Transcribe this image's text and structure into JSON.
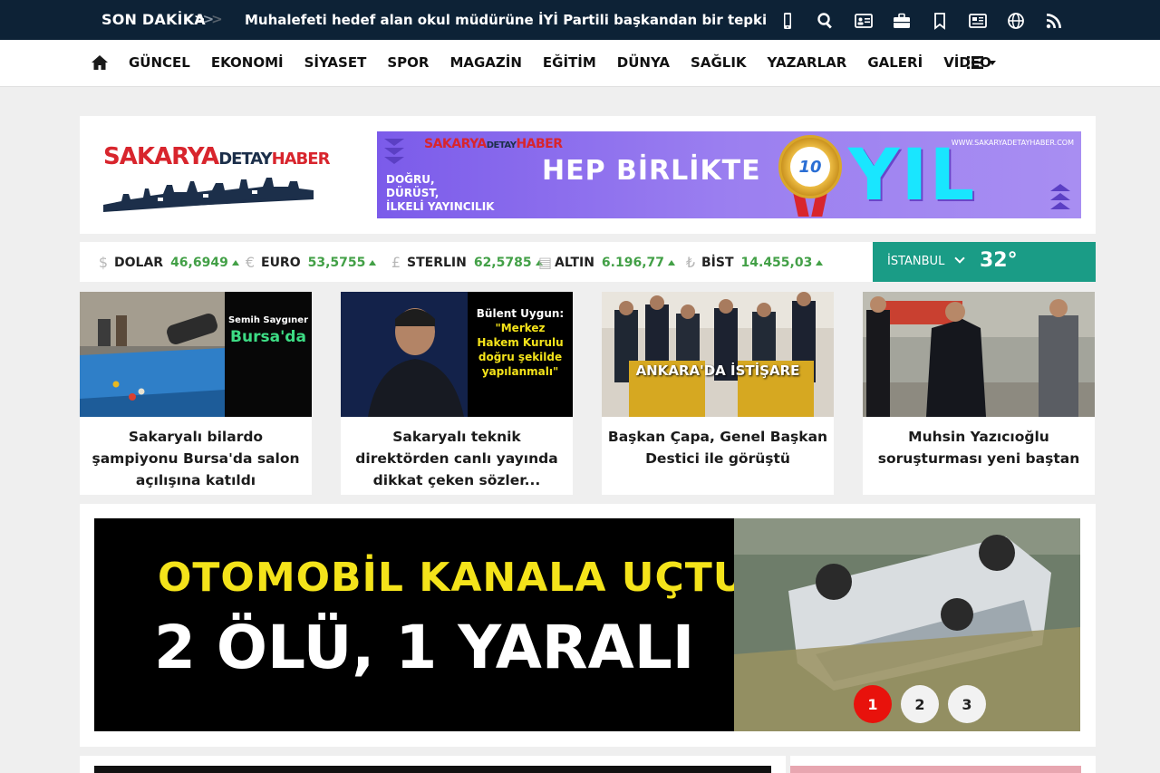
{
  "topbar": {
    "breaking_label": "SON DAKİKA",
    "headline": "Muhalefeti hedef alan okul müdürüne İYİ Partili başkandan bir tepki",
    "icons": [
      "mobile-icon",
      "search-icon",
      "id-card-icon",
      "briefcase-icon",
      "bookmark-icon",
      "newspaper-icon",
      "globe-icon",
      "rss-icon"
    ]
  },
  "nav": {
    "items": [
      "GÜNCEL",
      "EKONOMİ",
      "SİYASET",
      "SPOR",
      "MAGAZİN",
      "EĞİTİM",
      "DÜNYA",
      "SAĞLIK",
      "YAZARLAR",
      "GALERİ",
      "VİDEO"
    ]
  },
  "header": {
    "logo": {
      "part1": "SAKARYA",
      "part2": "DETAY",
      "part3": "HABER"
    },
    "banner": {
      "logo_part1": "SAKARYA",
      "logo_part2": "DETAY",
      "logo_part3": "HABER",
      "headline": "HEP BİRLİKTE",
      "slogan": [
        "DOĞRU,",
        "DÜRÜST,",
        "İLKELİ YAYINCILIK"
      ],
      "medal": "10",
      "big": "YIL",
      "url": "WWW.SAKARYADETAYHABER.COM"
    }
  },
  "finance": [
    {
      "symbol": "$",
      "name": "DOLAR",
      "value": "46,6949"
    },
    {
      "symbol": "€",
      "name": "EURO",
      "value": "53,5755"
    },
    {
      "symbol": "£",
      "name": "STERLIN",
      "value": "62,5785"
    },
    {
      "symbol": "▤",
      "name": "ALTIN",
      "value": "6.196,77"
    },
    {
      "symbol": "₺",
      "name": "BİST",
      "value": "14.455,03"
    }
  ],
  "weather": {
    "city": "İSTANBUL",
    "temp": "32°"
  },
  "cards": [
    {
      "overlay": [
        "Semih Saygıner",
        "Bursa'da"
      ],
      "title": "Sakaryalı bilardo şampiyonu Bursa'da salon açılışına katıldı"
    },
    {
      "overlay": [
        "Bülent Uygun:",
        "\"Merkez",
        "Hakem Kurulu",
        "doğru şekilde",
        "yapılanmalı\""
      ],
      "title": "Sakaryalı teknik direktörden canlı yayında dikkat çeken sözler..."
    },
    {
      "overlay": [
        "ANKARA'DA İSTİŞARE"
      ],
      "title": "Başkan Çapa, Genel Başkan Destici ile görüştü"
    },
    {
      "overlay": [],
      "title": "Muhsin Yazıcıoğlu soruşturması yeni baştan"
    }
  ],
  "slider": {
    "line1": "OTOMOBİL KANALA UÇTU",
    "line2": "2 ÖLÜ, 1 YARALI",
    "pages": [
      "1",
      "2",
      "3"
    ]
  },
  "colors": {
    "topbar": "#0d2236",
    "accent_green": "#43a047",
    "weather_bg": "#1a9c86",
    "pager_active": "#e8120c",
    "slide_yellow": "#f4e31a"
  }
}
